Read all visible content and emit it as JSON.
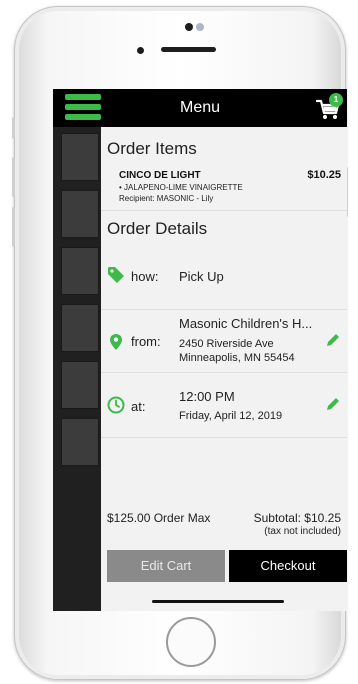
{
  "navbar": {
    "title": "Menu",
    "cart_count": "1"
  },
  "order_items": {
    "title": "Order Items",
    "items": [
      {
        "name": "CINCO DE LIGHT",
        "price": "$10.25",
        "modifier": "• JALAPENO-LIME VINAIGRETTE",
        "recipient": "Recipient: MASONIC - Lily"
      }
    ]
  },
  "order_details": {
    "title": "Order Details",
    "how": {
      "label": "how:",
      "value": "Pick Up"
    },
    "from": {
      "label": "from:",
      "name": "Masonic Children's H...",
      "address_line1": "2450 Riverside Ave",
      "address_line2": "Minneapolis, MN 55454"
    },
    "at": {
      "label": "at:",
      "time": "12:00 PM",
      "date": "Friday, April 12, 2019"
    }
  },
  "summary": {
    "order_max": "$125.00 Order Max",
    "subtotal": "Subtotal: $10.25",
    "tax_note": "(tax not included)"
  },
  "buttons": {
    "edit_cart": "Edit Cart",
    "checkout": "Checkout"
  },
  "colors": {
    "accent": "#3dba49",
    "navbar": "#000000",
    "edit_button": "#8a8a8a"
  },
  "icons": [
    "hamburger-menu-icon",
    "shopping-cart-icon",
    "tag-icon",
    "map-pin-icon",
    "clock-icon",
    "pencil-icon"
  ]
}
